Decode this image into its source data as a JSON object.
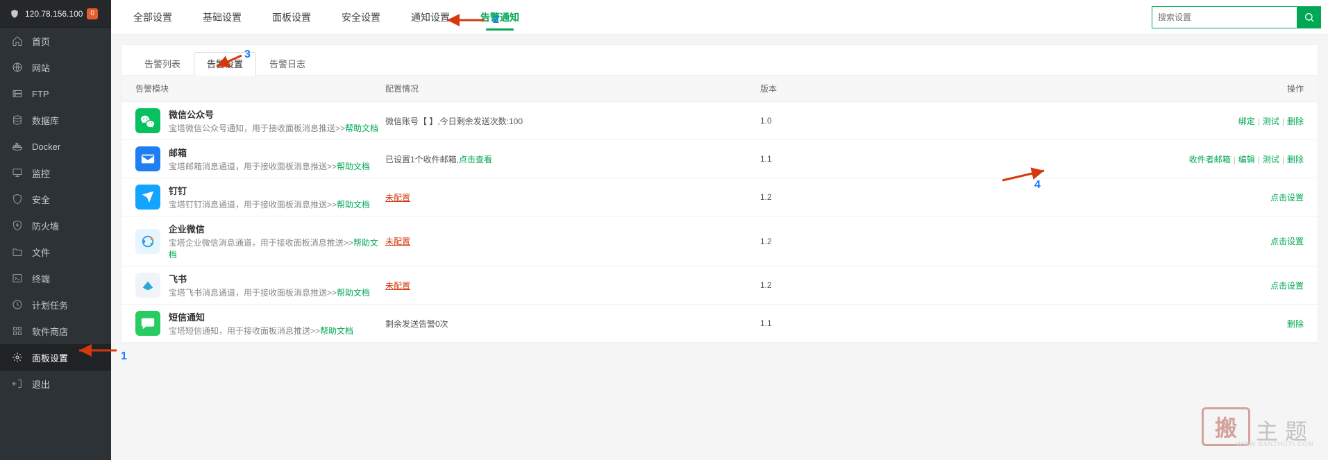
{
  "ip": "120.78.156.100",
  "badge": "0",
  "sidebar": [
    {
      "label": "首页",
      "icon": "home"
    },
    {
      "label": "网站",
      "icon": "globe"
    },
    {
      "label": "FTP",
      "icon": "ftp"
    },
    {
      "label": "数据库",
      "icon": "db"
    },
    {
      "label": "Docker",
      "icon": "docker"
    },
    {
      "label": "监控",
      "icon": "monitor"
    },
    {
      "label": "安全",
      "icon": "shield"
    },
    {
      "label": "防火墙",
      "icon": "fire"
    },
    {
      "label": "文件",
      "icon": "folder"
    },
    {
      "label": "终端",
      "icon": "terminal"
    },
    {
      "label": "计划任务",
      "icon": "clock"
    },
    {
      "label": "软件商店",
      "icon": "grid"
    },
    {
      "label": "面板设置",
      "icon": "gear",
      "active": true
    },
    {
      "label": "退出",
      "icon": "exit"
    }
  ],
  "tabs": [
    "全部设置",
    "基础设置",
    "面板设置",
    "安全设置",
    "通知设置",
    "告警通知"
  ],
  "active_tab": 5,
  "search_placeholder": "搜索设置",
  "subtabs": [
    "告警列表",
    "告警设置",
    "告警日志"
  ],
  "active_subtab": 1,
  "columns": {
    "mod": "告警模块",
    "cfg": "配置情况",
    "ver": "版本",
    "op": "操作"
  },
  "help_text": "帮助文档",
  "rows": [
    {
      "icon": "wechat",
      "color": "#07c160",
      "title": "微信公众号",
      "desc": "宝塔微信公众号通知，用于接收面板消息推送>>",
      "cfg_text": "微信账号【   】,今日剩余发送次数:100",
      "ver": "1.0",
      "ops": [
        "绑定",
        "测试",
        "删除"
      ]
    },
    {
      "icon": "mail",
      "color": "#1f7ef2",
      "title": "邮箱",
      "desc": "宝塔邮箱消息通道，用于接收面板消息推送>>",
      "cfg_text": "已设置1个收件邮箱,",
      "cfg_link": "点击查看",
      "ver": "1.1",
      "ops": [
        "收件者邮箱",
        "编辑",
        "测试",
        "删除"
      ]
    },
    {
      "icon": "ding",
      "color": "#12a4ff",
      "title": "钉钉",
      "desc": "宝塔钉钉消息通道，用于接收面板消息推送>>",
      "cfg_warn": "未配置",
      "ver": "1.2",
      "ops": [
        "点击设置"
      ]
    },
    {
      "icon": "qywx",
      "color": "#e8f5ff",
      "title": "企业微信",
      "desc": "宝塔企业微信消息通道，用于接收面板消息推送>>",
      "cfg_warn": "未配置",
      "ver": "1.2",
      "ops": [
        "点击设置"
      ]
    },
    {
      "icon": "feishu",
      "color": "#f0f4f8",
      "title": "飞书",
      "desc": "宝塔飞书消息通道，用于接收面板消息推送>>",
      "cfg_warn": "未配置",
      "ver": "1.2",
      "ops": [
        "点击设置"
      ]
    },
    {
      "icon": "sms",
      "color": "#29cc60",
      "title": "短信通知",
      "desc": "宝塔短信通知，用于接收面板消息推送>>",
      "cfg_text": "剩余发送告警0次",
      "ver": "1.1",
      "ops": [
        "删除"
      ]
    }
  ],
  "annotations": {
    "n1": "1",
    "n2": "2",
    "n3": "3",
    "n4": "4"
  },
  "watermark": {
    "stamp": "搬",
    "txt": "主题",
    "url": "WWW.BANZHUTI.COM"
  }
}
